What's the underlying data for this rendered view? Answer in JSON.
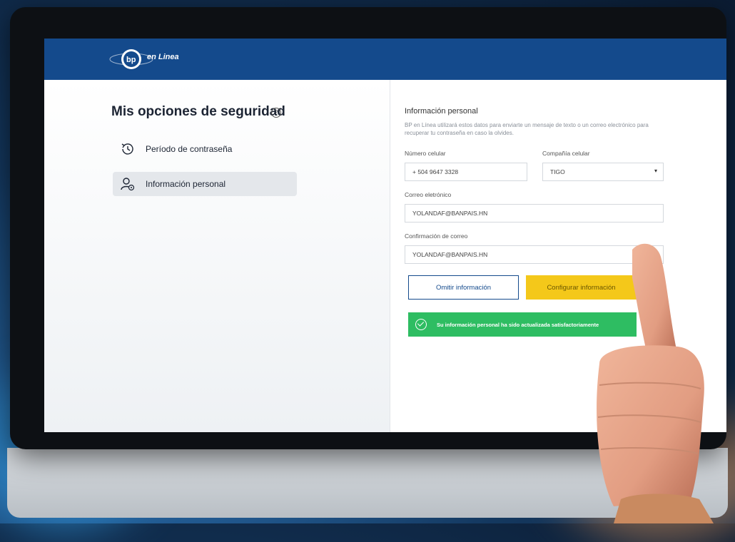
{
  "header": {
    "logo_text": "en Linea"
  },
  "sidebar": {
    "title": "Mis opciones de seguridad",
    "items": [
      {
        "label": "Período de contraseña",
        "icon": "history-icon",
        "active": false
      },
      {
        "label": "Información personal",
        "icon": "user-settings-icon",
        "active": true
      }
    ]
  },
  "form": {
    "section_title": "Información personal",
    "description": "BP en Línea utilizará estos datos para enviarte un mensaje de texto o un correo electrónico para recuperar tu contraseña en caso la olvides.",
    "phone_label": "Número celular",
    "phone_value": "+ 504 9647 3328",
    "carrier_label": "Compañía celular",
    "carrier_value": "TIGO",
    "email_label": "Correo eletrónico",
    "email_value": "YOLANDAF@BANPAIS.HN",
    "confirm_label": "Confirmación de correo",
    "confirm_value": "YOLANDAF@BANPAIS.HN",
    "skip_button": "Omitir información",
    "configure_button": "Configurar información",
    "success_message": "Su información personal ha sido actualizada satisfactoriamente"
  },
  "colors": {
    "brand_blue": "#144a8c",
    "accent_yellow": "#f4c81a",
    "success_green": "#2ebd62"
  }
}
